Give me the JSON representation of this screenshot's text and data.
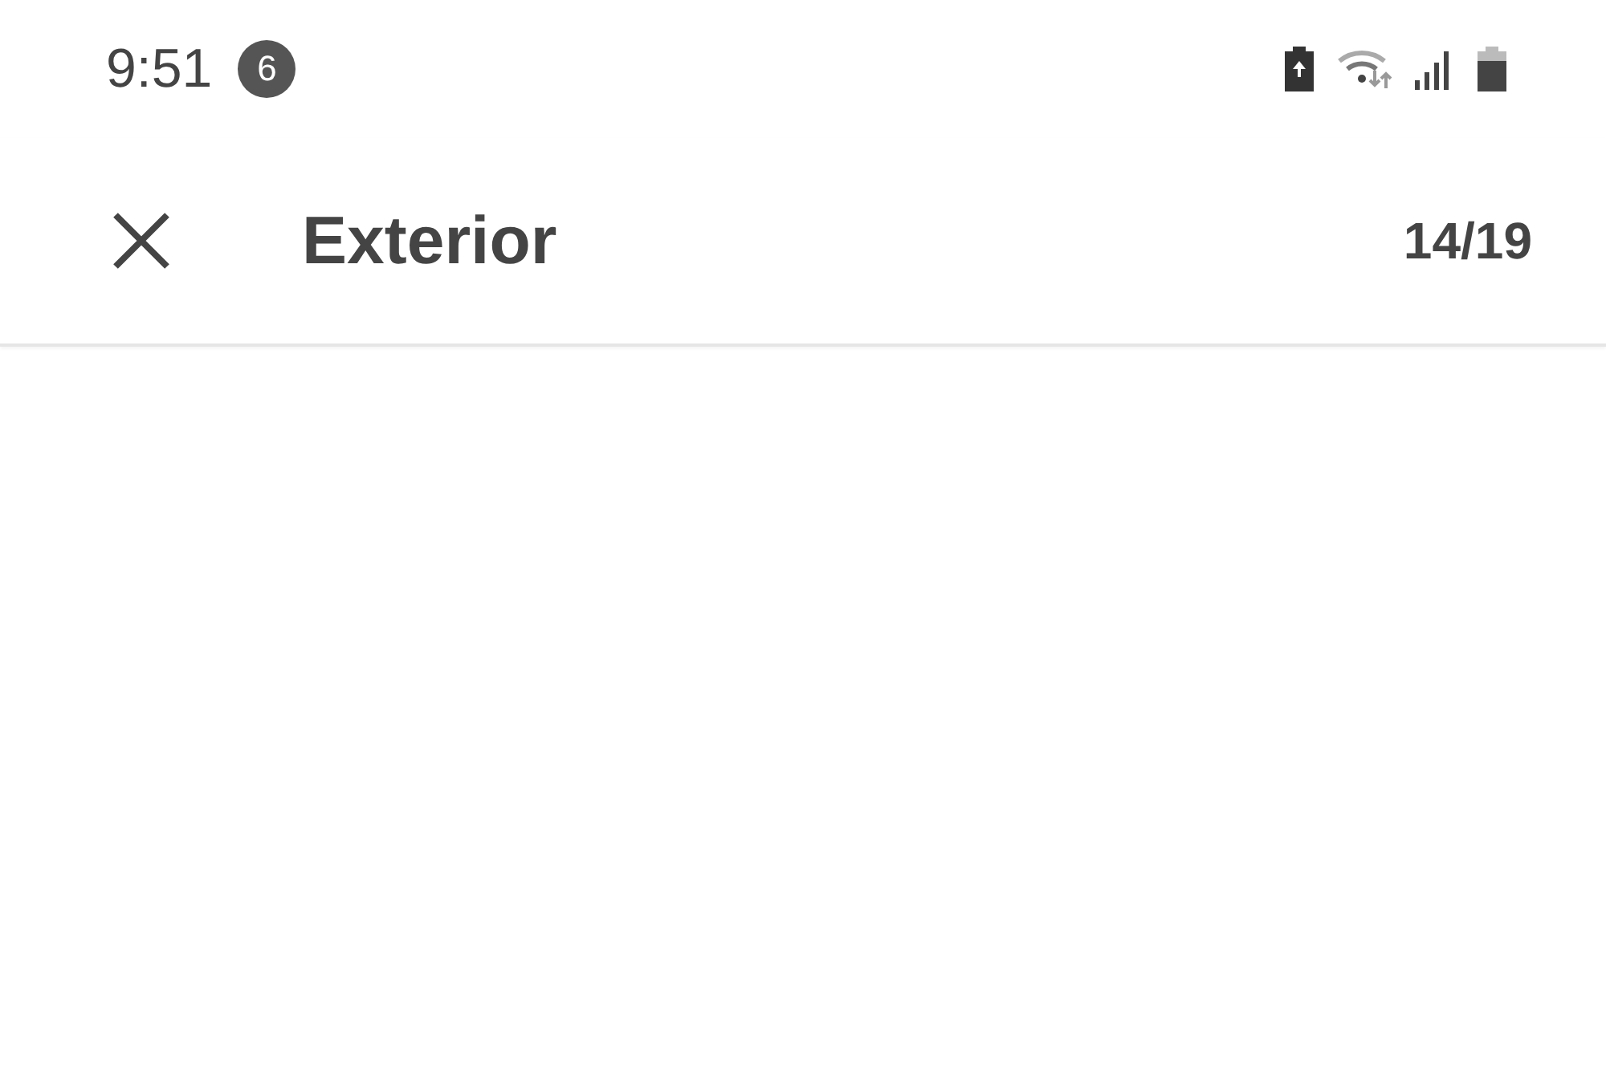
{
  "status_bar": {
    "time": "9:51",
    "notification_count": "6"
  },
  "app_bar": {
    "title": "Exterior",
    "counter": "14/19"
  }
}
